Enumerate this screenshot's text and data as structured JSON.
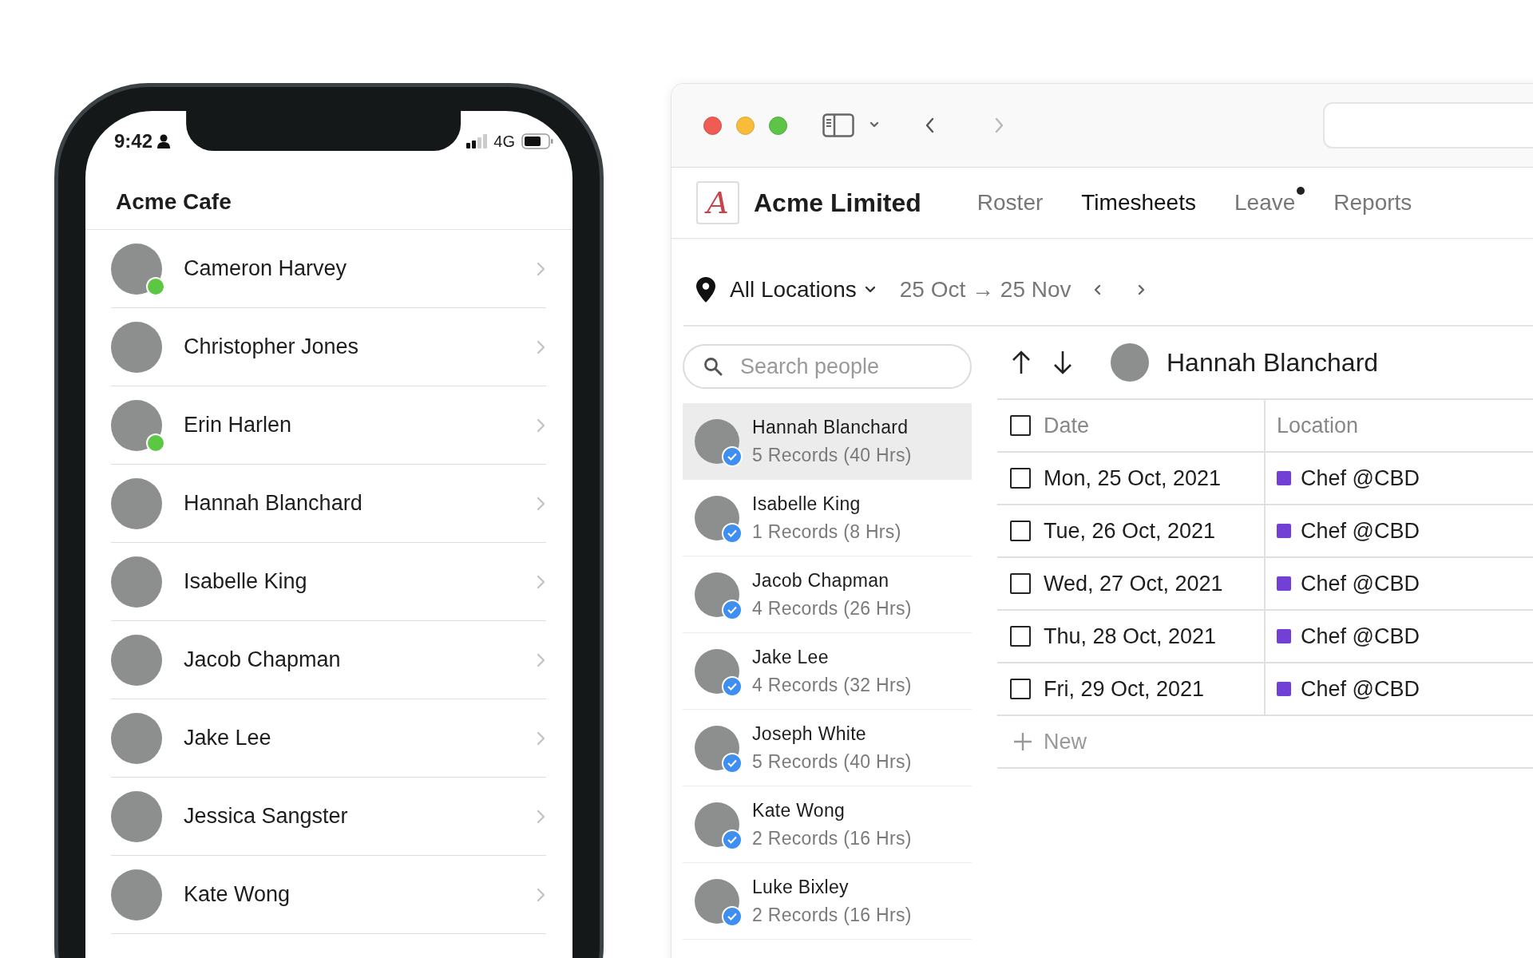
{
  "phone": {
    "status_time": "9:42",
    "network": "4G",
    "title": "Acme Cafe",
    "contacts": [
      {
        "name": "Cameron Harvey",
        "online": true
      },
      {
        "name": "Christopher Jones",
        "online": false
      },
      {
        "name": "Erin Harlen",
        "online": true
      },
      {
        "name": "Hannah Blanchard",
        "online": false
      },
      {
        "name": "Isabelle King",
        "online": false
      },
      {
        "name": "Jacob Chapman",
        "online": false
      },
      {
        "name": "Jake Lee",
        "online": false
      },
      {
        "name": "Jessica Sangster",
        "online": false
      },
      {
        "name": "Kate Wong",
        "online": false
      }
    ]
  },
  "window": {
    "toolbar": {
      "back_disabled": false,
      "forward_disabled": true
    },
    "app": {
      "logo": "A",
      "name": "Acme Limited",
      "nav": [
        {
          "label": "Roster",
          "selected": false,
          "badge": false
        },
        {
          "label": "Timesheets",
          "selected": true,
          "badge": false
        },
        {
          "label": "Leave",
          "selected": false,
          "badge": true
        },
        {
          "label": "Reports",
          "selected": false,
          "badge": false
        }
      ]
    },
    "filter": {
      "location": "All Locations",
      "date_range": "25 Oct → 25 Nov"
    },
    "search": {
      "placeholder": "Search people"
    },
    "people": [
      {
        "name": "Hannah Blanchard",
        "summary": "5 Records (40 Hrs)",
        "selected": true,
        "verified": true
      },
      {
        "name": "Isabelle King",
        "summary": "1 Records (8 Hrs)",
        "selected": false,
        "verified": true
      },
      {
        "name": "Jacob Chapman",
        "summary": "4 Records (26 Hrs)",
        "selected": false,
        "verified": true
      },
      {
        "name": "Jake Lee",
        "summary": "4 Records (32 Hrs)",
        "selected": false,
        "verified": true
      },
      {
        "name": "Joseph White",
        "summary": "5 Records (40 Hrs)",
        "selected": false,
        "verified": true
      },
      {
        "name": "Kate Wong",
        "summary": "2 Records (16 Hrs)",
        "selected": false,
        "verified": true
      },
      {
        "name": "Luke Bixley",
        "summary": "2 Records (16 Hrs)",
        "selected": false,
        "verified": true
      }
    ],
    "detail": {
      "person": "Hannah Blanchard",
      "header_checked": false,
      "columns": [
        "Date",
        "Location"
      ],
      "rows": [
        {
          "checked": false,
          "date": "Mon, 25 Oct, 2021",
          "location": "Chef @CBD",
          "color": "#7340d6"
        },
        {
          "checked": false,
          "date": "Tue, 26 Oct, 2021",
          "location": "Chef @CBD",
          "color": "#7340d6"
        },
        {
          "checked": false,
          "date": "Wed, 27 Oct, 2021",
          "location": "Chef @CBD",
          "color": "#7340d6"
        },
        {
          "checked": false,
          "date": "Thu, 28 Oct, 2021",
          "location": "Chef @CBD",
          "color": "#7340d6"
        },
        {
          "checked": false,
          "date": "Fri, 29 Oct, 2021",
          "location": "Chef @CBD",
          "color": "#7340d6"
        }
      ],
      "new_label": "New"
    }
  }
}
